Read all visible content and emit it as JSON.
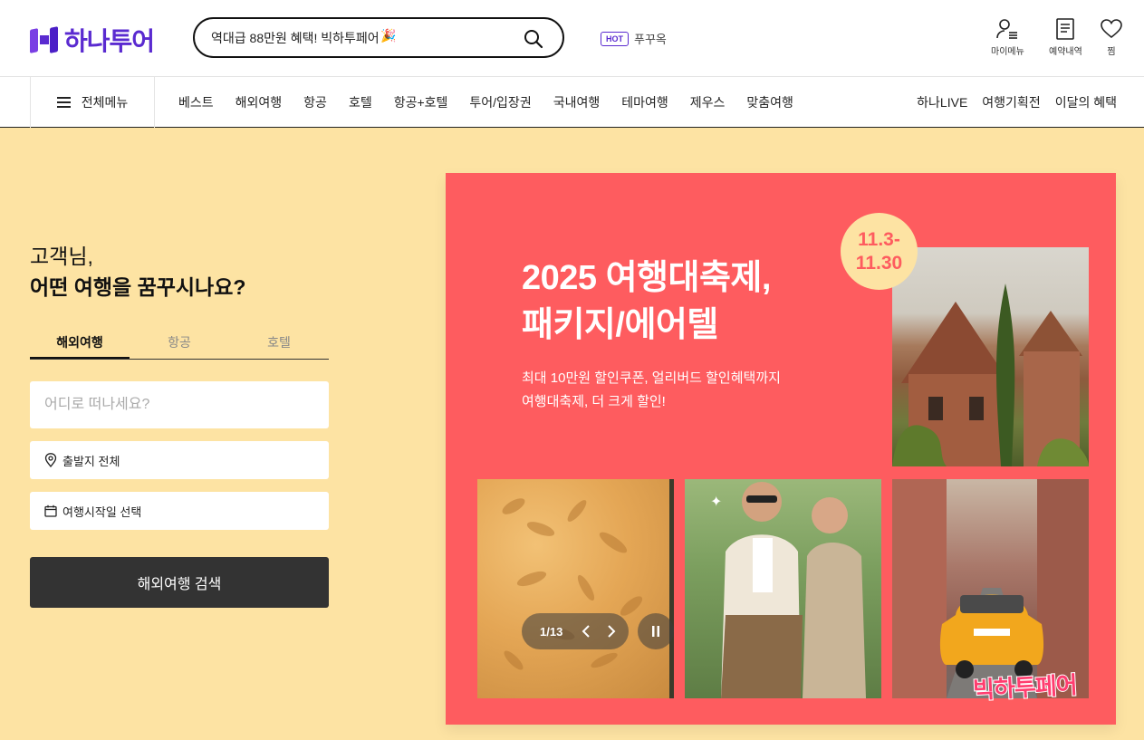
{
  "brand": {
    "name": "하나투어",
    "color": "#5a2ad0"
  },
  "search": {
    "value": "역대급 88만원 혜택! 빅하투페어",
    "emoji": "🎉"
  },
  "hot": {
    "badge": "HOT",
    "text": "푸꾸옥"
  },
  "utilities": [
    {
      "label": "마이메뉴",
      "icon": "user-menu-icon"
    },
    {
      "label": "예약내역",
      "icon": "document-icon"
    },
    {
      "label": "찜",
      "icon": "heart-icon"
    }
  ],
  "nav": {
    "all_menu": "전체메뉴",
    "items": [
      "베스트",
      "해외여행",
      "항공",
      "호텔",
      "항공+호텔",
      "투어/입장권",
      "국내여행",
      "테마여행",
      "제우스",
      "맞춤여행"
    ],
    "right": [
      "하나LIVE",
      "여행기획전",
      "이달의 혜택"
    ]
  },
  "greeting": {
    "line1": "고객님,",
    "line2": "어떤 여행을 꿈꾸시나요?"
  },
  "tabs": {
    "items": [
      "해외여행",
      "항공",
      "호텔"
    ],
    "active": "해외여행"
  },
  "form": {
    "destination_placeholder": "어디로 떠나세요?",
    "departure": "출발지 전체",
    "date": "여행시작일 선택",
    "submit": "해외여행 검색"
  },
  "banner": {
    "title_line1": "2025 여행대축제,",
    "title_line2": "패키지/에어텔",
    "sub_line1": "최대 10만원 할인쿠폰, 얼리버드 할인혜택까지",
    "sub_line2": "여행대축제, 더 크게 할인!",
    "date_line1": "11.3-",
    "date_line2": "11.30",
    "counter": "1/13",
    "fair_logo": "빅하투페어",
    "bg_color": "#fe5c5f",
    "page_bg": "#fde3a3"
  }
}
